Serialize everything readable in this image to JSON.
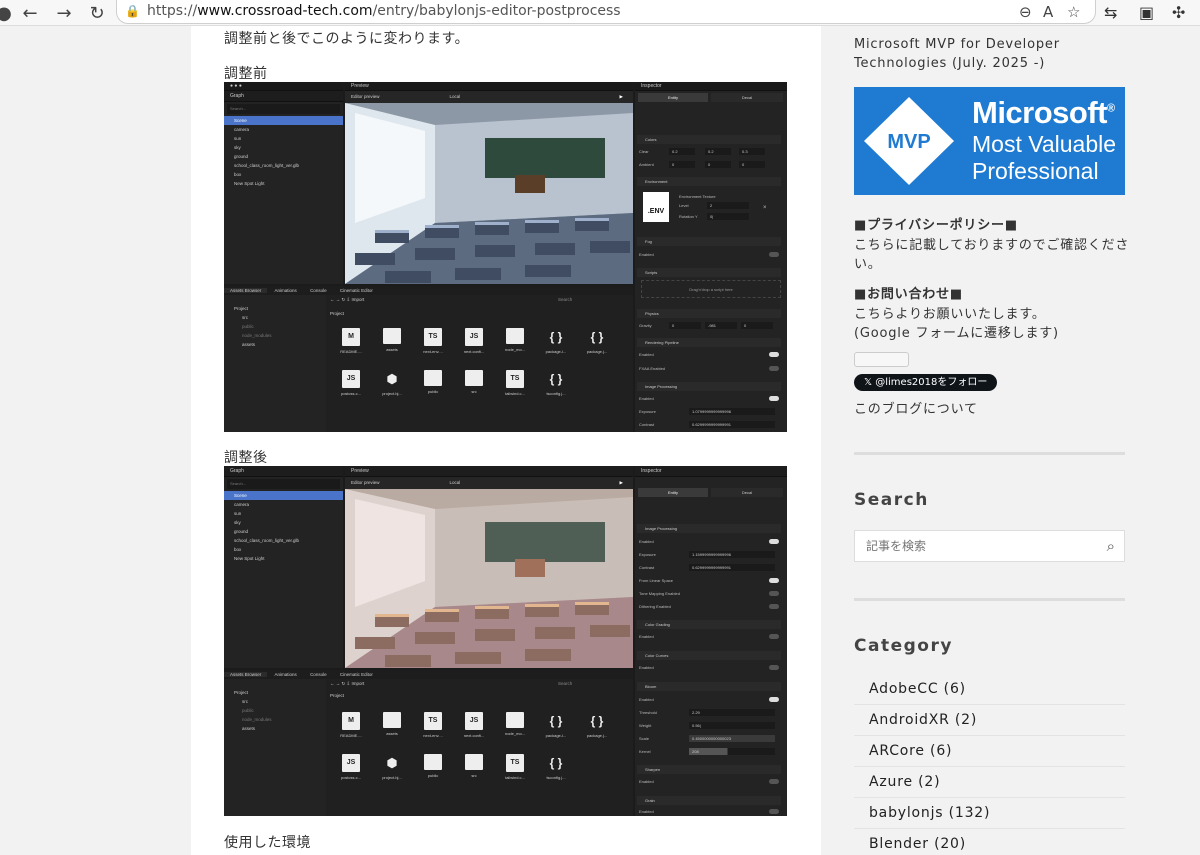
{
  "browser": {
    "url_prefix": "https://",
    "url_host": "www.crossroad-tech.com",
    "url_path": "/entry/babylonjs-editor-postprocess"
  },
  "article": {
    "intro": "調整前と後でこのように変わります。",
    "before_heading": "調整前",
    "after_heading": "調整後",
    "env_heading": "使用した環境"
  },
  "editor": {
    "graph_title": "Graph",
    "preview_title": "Preview",
    "inspector_title": "Inspector",
    "search_placeholder": "Search...",
    "editor_preview": "Editor preview",
    "local": "Local",
    "entity_tab": "Entity",
    "decal_tab": "Decal",
    "tree": [
      "Scene",
      "camera",
      "sun",
      "sky",
      "ground",
      "school_class_room_light_ver.glb",
      "box",
      "New Spot Light"
    ],
    "bottom_tabs": [
      "Assets Browser",
      "Animations",
      "Console",
      "Cinematic Editor"
    ],
    "project_label": "Project",
    "project_tree": [
      "Project",
      "src",
      "public",
      "node_modules",
      "assets"
    ],
    "import_label": "Import",
    "search_label": "Search",
    "assets_row1": [
      {
        "glyph": "M",
        "label": "README....",
        "kind": "file"
      },
      {
        "glyph": "",
        "label": "assets",
        "kind": "folder"
      },
      {
        "glyph": "TS",
        "label": "next-env....",
        "kind": "file"
      },
      {
        "glyph": "JS",
        "label": "next.confi...",
        "kind": "file"
      },
      {
        "glyph": "",
        "label": "node_mo...",
        "kind": "folder"
      },
      {
        "glyph": "{ }",
        "label": "package-l...",
        "kind": "brace"
      },
      {
        "glyph": "{ }",
        "label": "package.j...",
        "kind": "brace"
      }
    ],
    "assets_row2": [
      {
        "glyph": "JS",
        "label": "postcss.c...",
        "kind": "file"
      },
      {
        "glyph": "⬢",
        "label": "project.bj...",
        "kind": "brace"
      },
      {
        "glyph": "",
        "label": "public",
        "kind": "folder"
      },
      {
        "glyph": "",
        "label": "src",
        "kind": "folder"
      },
      {
        "glyph": "TS",
        "label": "tailwind.c...",
        "kind": "file"
      },
      {
        "glyph": "{ }",
        "label": "tsconfig.j...",
        "kind": "brace"
      }
    ],
    "before_inspector": {
      "colors": "Colors",
      "clear": "Clear",
      "ambient": "Ambient",
      "clear_vals": [
        "0.2",
        "0.2",
        "0.3"
      ],
      "ambient_vals": [
        "0",
        "0",
        "0"
      ],
      "environment": "Environment",
      "env_texture": "Environment Texture",
      "env_badge": ".ENV",
      "level": "Level",
      "level_val": "2",
      "rotation": "Rotation Y",
      "rotation_val": "0|",
      "fog": "Fog",
      "enabled": "Enabled",
      "scripts": "Scripts",
      "drop_script": "Drag'n'drop a script here",
      "physics": "Physics",
      "gravity": "Gravity",
      "gravity_vals": [
        "0",
        "-981",
        "0"
      ],
      "rendering": "Rendering Pipeline",
      "fxaa": "FXAA Enabled",
      "imgproc": "Image Processing",
      "exposure": "Exposure",
      "exposure_val": "1.0799999999999996",
      "contrast": "Contrast",
      "contrast_val": "0.6299999999999991"
    },
    "after_inspector": {
      "imgproc": "Image Processing",
      "enabled": "Enabled",
      "exposure": "Exposure",
      "exposure_val": "1.1599999999999996",
      "contrast": "Contrast",
      "contrast_val": "0.6299999999999991",
      "linear": "From Linear Space",
      "tonemap": "Tone Mapping Enabled",
      "dither": "Dithering Enabled",
      "grading": "Color Grading",
      "curves": "Color Curves",
      "bloom": "Bloom",
      "threshold": "Threshold",
      "threshold_val": "2.29",
      "weight": "Weight",
      "weight_val": "0.56|",
      "scale": "Scale",
      "scale_val": "0.4500000000000023",
      "kernel": "Kernel",
      "kernel_val": "208",
      "sharpen": "Sharpen",
      "grain": "Grain"
    }
  },
  "sidebar": {
    "mvp_line1": "Microsoft MVP for Developer",
    "mvp_line2": "Technologies (July. 2025 -)",
    "badge_mvp": "MVP",
    "badge_ms": "Microsoft",
    "badge_reg": "®",
    "badge_most": "Most Valuable",
    "badge_prof": "Professional",
    "privacy_heading": "■プライバシーポリシー■",
    "privacy_line1": "こちらに記載しておりますのでご確認くださ",
    "privacy_line2": "い。",
    "contact_heading": "■お問い合わせ■",
    "contact_line1": "こちらよりお願いいたします。",
    "contact_line2": "(Google フォームに遷移します)",
    "follow_label": "@limes2018をフォロー",
    "about": "このブログについて",
    "search_heading": "Search",
    "search_placeholder": "記事を検索",
    "category_heading": "Category",
    "categories": [
      "AdobeCC (6)",
      "AndroidXR (2)",
      "ARCore (6)",
      "Azure (2)",
      "babylonjs (132)",
      "Blender (20)"
    ]
  },
  "colors": {
    "mvp_blue": "#1f7bd1",
    "selection": "#4a74c9"
  }
}
